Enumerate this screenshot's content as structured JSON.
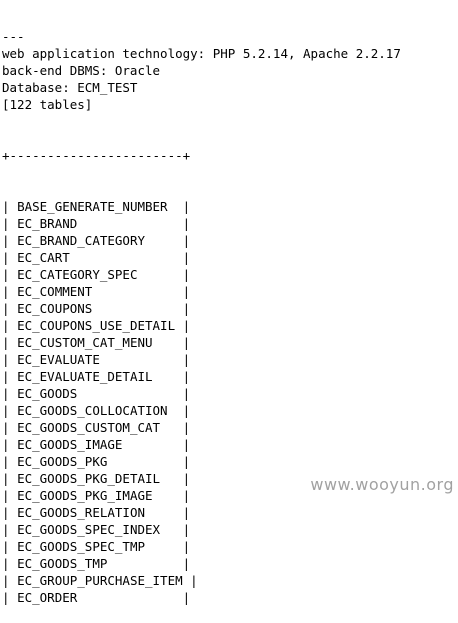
{
  "terminal": {
    "header_lines": [
      "---",
      "web application technology: PHP 5.2.14, Apache 2.2.17",
      "back-end DBMS: Oracle",
      "Database: ECM_TEST",
      "[122 tables]"
    ],
    "table_border": "+-----------------------+",
    "tables": [
      "BASE_GENERATE_NUMBER",
      "EC_BRAND",
      "EC_BRAND_CATEGORY",
      "EC_CART",
      "EC_CATEGORY_SPEC",
      "EC_COMMENT",
      "EC_COUPONS",
      "EC_COUPONS_USE_DETAIL",
      "EC_CUSTOM_CAT_MENU",
      "EC_EVALUATE",
      "EC_EVALUATE_DETAIL",
      "EC_GOODS",
      "EC_GOODS_COLLOCATION",
      "EC_GOODS_CUSTOM_CAT",
      "EC_GOODS_IMAGE",
      "EC_GOODS_PKG",
      "EC_GOODS_PKG_DETAIL",
      "EC_GOODS_PKG_IMAGE",
      "EC_GOODS_RELATION",
      "EC_GOODS_SPEC_INDEX",
      "EC_GOODS_SPEC_TMP",
      "EC_GOODS_TMP",
      "EC_GROUP_PURCHASE_ITEM",
      "EC_ORDER"
    ]
  },
  "watermark": "www.wooyun.org"
}
